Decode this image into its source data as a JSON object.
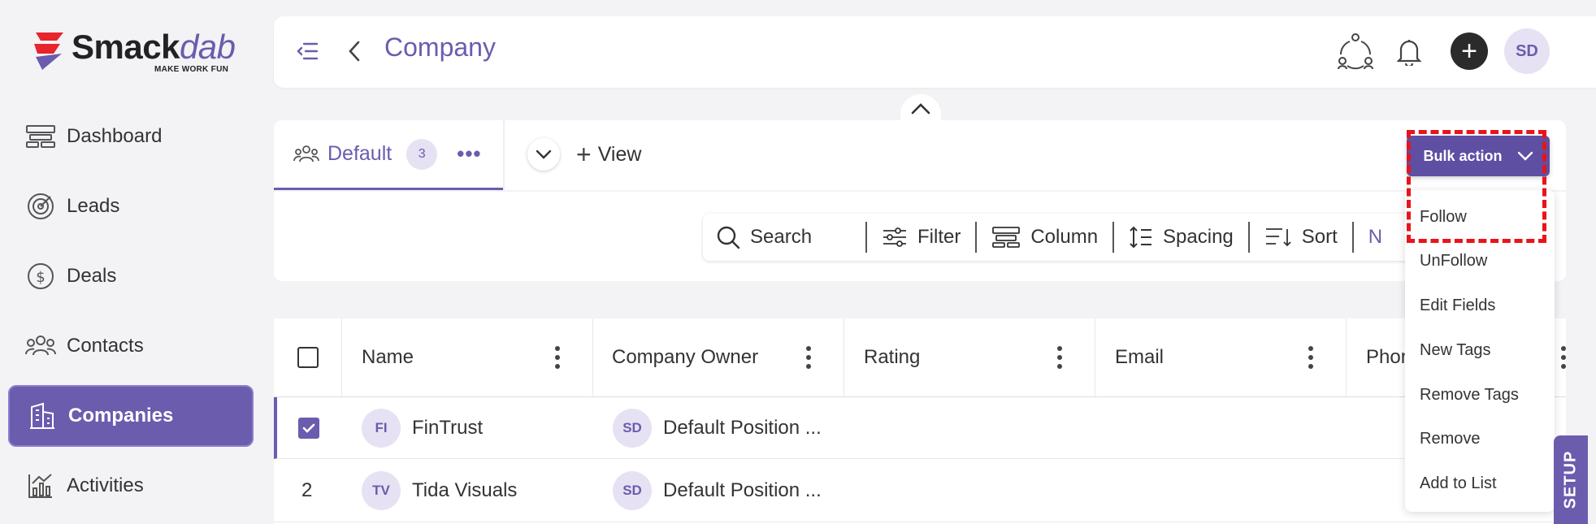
{
  "app": {
    "logo_main": "Smack",
    "logo_accent": "dab",
    "logo_tagline": "MAKE WORK FUN"
  },
  "sidebar": {
    "items": [
      {
        "label": "Dashboard",
        "icon": "dashboard-icon",
        "active": false
      },
      {
        "label": "Leads",
        "icon": "target-icon",
        "active": false
      },
      {
        "label": "Deals",
        "icon": "dollar-icon",
        "active": false
      },
      {
        "label": "Contacts",
        "icon": "contacts-icon",
        "active": false
      },
      {
        "label": "Companies",
        "icon": "building-icon",
        "active": true
      },
      {
        "label": "Activities",
        "icon": "activity-icon",
        "active": false
      }
    ]
  },
  "header": {
    "title": "Company",
    "avatar_initials": "SD",
    "add_symbol": "+"
  },
  "tabs": {
    "default_label": "Default",
    "default_count": "3",
    "more": "•••",
    "add_view_label": "View",
    "add_view_symbol": "+"
  },
  "toolbar": {
    "search": "Search",
    "filter": "Filter",
    "column": "Column",
    "spacing": "Spacing",
    "sort": "Sort",
    "truncated": "N"
  },
  "table": {
    "columns": [
      "Name",
      "Company Owner",
      "Rating",
      "Email",
      "Phon"
    ],
    "rows": [
      {
        "index": "",
        "checked": true,
        "name_initials": "FI",
        "name": "FinTrust",
        "owner_initials": "SD",
        "owner": "Default Position ..."
      },
      {
        "index": "2",
        "checked": false,
        "name_initials": "TV",
        "name": "Tida Visuals",
        "owner_initials": "SD",
        "owner": "Default Position ..."
      }
    ]
  },
  "bulk_action": {
    "label": "Bulk action",
    "items": [
      "Follow",
      "UnFollow",
      "Edit Fields",
      "New Tags",
      "Remove Tags",
      "Remove",
      "Add to List"
    ]
  },
  "setup_label": "SETUP",
  "colors": {
    "primary": "#6b5cae",
    "primary_dark": "#5e4fa3",
    "highlight": "#e8141c",
    "avatar_bg": "#e6e2f4"
  }
}
